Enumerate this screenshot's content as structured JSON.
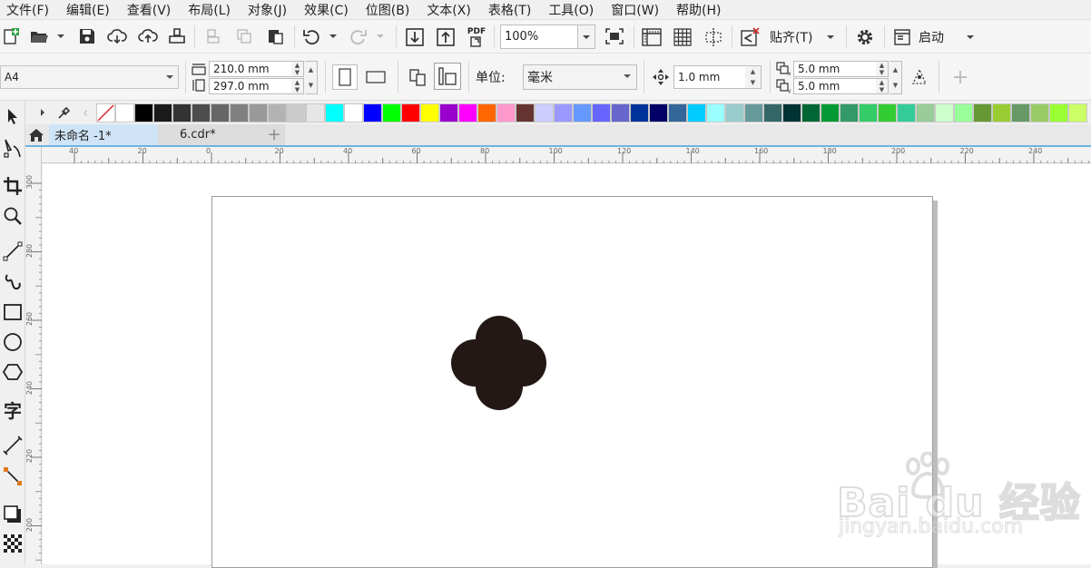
{
  "menu": [
    "文件(F)",
    "编辑(E)",
    "查看(V)",
    "布局(L)",
    "对象(J)",
    "效果(C)",
    "位图(B)",
    "文本(X)",
    "表格(T)",
    "工具(O)",
    "窗口(W)",
    "帮助(H)"
  ],
  "toolbar": {
    "zoom_value": "100%",
    "pdf_label": "PDF",
    "snap_label": "贴齐(T)",
    "launch_label": "启动"
  },
  "property_bar": {
    "page_size": "A4",
    "width": "210.0 mm",
    "height": "297.0 mm",
    "units_label": "单位:",
    "units_value": "毫米",
    "nudge": "1.0 mm",
    "dup_x": "5.0 mm",
    "dup_y": "5.0 mm"
  },
  "palette": [
    "#ffffff",
    "#000000",
    "#1a1a1a",
    "#333333",
    "#4d4d4d",
    "#666666",
    "#808080",
    "#999999",
    "#b3b3b3",
    "#cccccc",
    "#e6e6e6",
    "#00ffff",
    "#ffffff",
    "#0000ff",
    "#00ff00",
    "#ff0000",
    "#ffff00",
    "#9900cc",
    "#ff00ff",
    "#ff6600",
    "#ff99cc",
    "#663333",
    "#ccccff",
    "#9999ff",
    "#6699ff",
    "#6666ff",
    "#6666cc",
    "#003399",
    "#000066",
    "#336699",
    "#00ccff",
    "#99ffff",
    "#99cccc",
    "#669999",
    "#336666",
    "#003333",
    "#006633",
    "#009933",
    "#339966",
    "#33cc66",
    "#33cc33",
    "#33cc99",
    "#99cc99",
    "#ccffcc",
    "#99ff99",
    "#669933",
    "#99cc33",
    "#669966",
    "#99cc66",
    "#99ff33",
    "#ccff66"
  ],
  "tabs": [
    {
      "label": "未命名 -1*"
    },
    {
      "label": "6.cdr*"
    }
  ],
  "ruler_h": [
    "40",
    "20",
    "0",
    "20",
    "40",
    "60",
    "80",
    "100",
    "120",
    "140",
    "160",
    "180",
    "200",
    "220",
    "240"
  ],
  "ruler_v": [
    "300",
    "280",
    "260",
    "240",
    "220",
    "200"
  ],
  "shape_color": "#231815",
  "watermark": {
    "logo": "Bai du 经验",
    "url": "jingyan.baidu.com"
  }
}
